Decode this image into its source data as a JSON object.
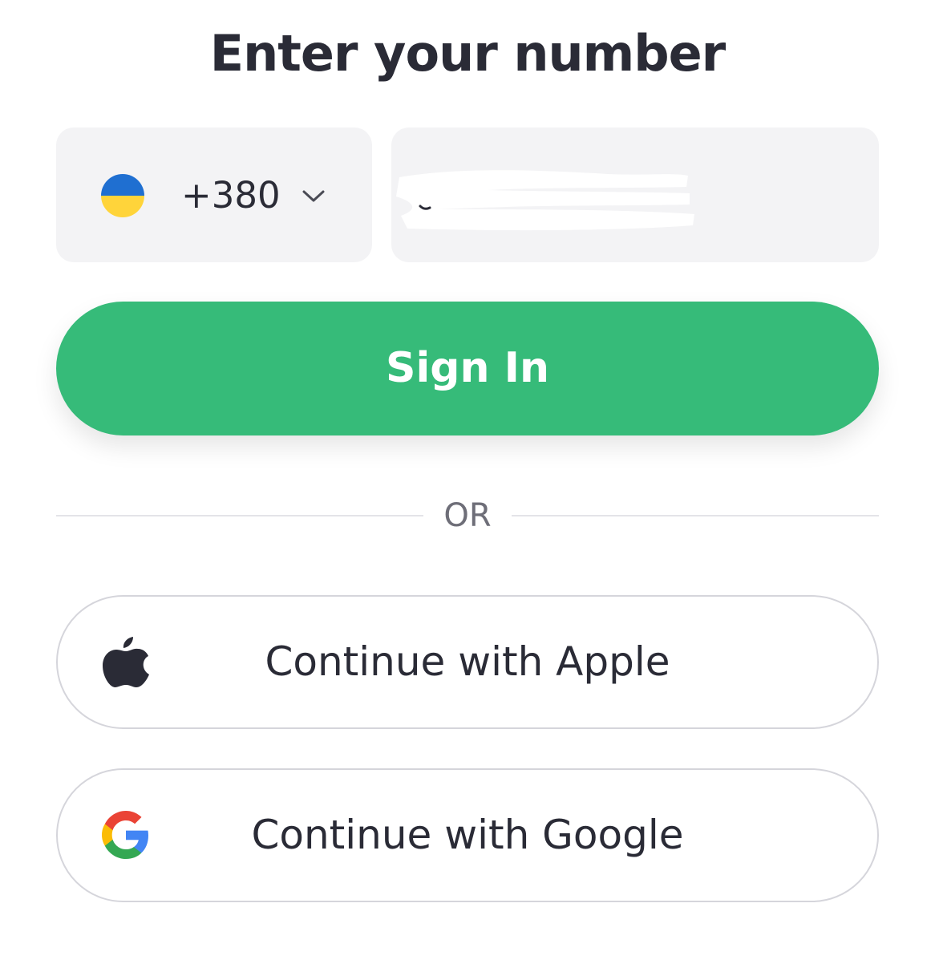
{
  "title": "Enter your number",
  "phone": {
    "country": {
      "flag": "ukraine-flag-icon",
      "dial_code": "+380",
      "dropdown_icon": "chevron-down-icon",
      "flag_colors": {
        "top": "#1f6fd1",
        "bottom": "#ffd43a"
      }
    },
    "number_value": ""
  },
  "signin": {
    "label": "Sign In",
    "color": "#36bb79"
  },
  "divider": {
    "label": "OR"
  },
  "oauth": {
    "apple": {
      "label": "Continue with Apple",
      "icon": "apple-icon"
    },
    "google": {
      "label": "Continue with Google",
      "icon": "google-icon"
    }
  }
}
